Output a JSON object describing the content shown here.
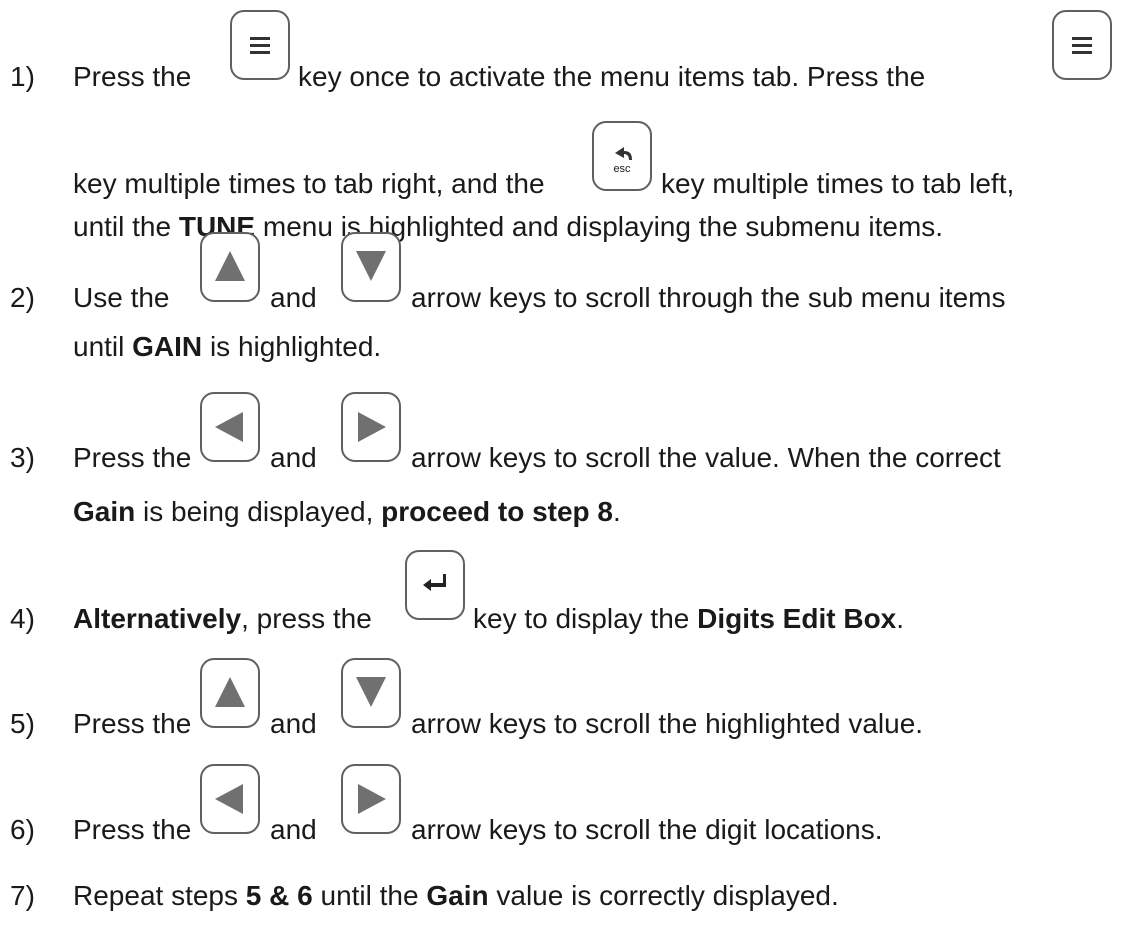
{
  "steps": [
    {
      "num": "1)",
      "t1": "Press the",
      "t2": "key once to activate the menu items tab.  Press the",
      "t3": "key multiple times to tab right, and the",
      "t4": "key multiple times to tab left,",
      "t5": "until the",
      "b1": "TUNE",
      "t6": "menu is highlighted and displaying the submenu items."
    },
    {
      "num": "2)",
      "t1": "Use the",
      "t2": "and",
      "t3": "arrow keys to scroll through the sub menu items",
      "t4": "until",
      "b1": "GAIN",
      "t5": "is highlighted."
    },
    {
      "num": "3)",
      "t1": "Press the",
      "t2": "and",
      "t3": "arrow keys to scroll the value.  When the correct",
      "b1": "Gain",
      "t4": "is being displayed,",
      "b2": "proceed to step 8",
      "t5": "."
    },
    {
      "num": "4)",
      "b1": "Alternatively",
      "t1": ", press the",
      "t2": "key to display the",
      "b2": "Digits Edit Box",
      "t3": "."
    },
    {
      "num": "5)",
      "t1": "Press the",
      "t2": "and",
      "t3": "arrow keys to scroll the highlighted value."
    },
    {
      "num": "6)",
      "t1": "Press the",
      "t2": "and",
      "t3": "arrow keys to scroll the digit locations."
    },
    {
      "num": "7)",
      "t1": "Repeat steps",
      "b1": "5 & 6",
      "t2": "until the",
      "b2": "Gain",
      "t3": "value is correctly displayed."
    }
  ],
  "keys": {
    "esc_label": "esc",
    "menu_icon": "menu-icon",
    "back_icon": "back-arrow-icon",
    "up_icon": "up-triangle-icon",
    "down_icon": "down-triangle-icon",
    "left_icon": "left-triangle-icon",
    "right_icon": "right-triangle-icon",
    "enter_icon": "enter-icon",
    "icon_color": "#707070",
    "border_color": "#606060"
  }
}
